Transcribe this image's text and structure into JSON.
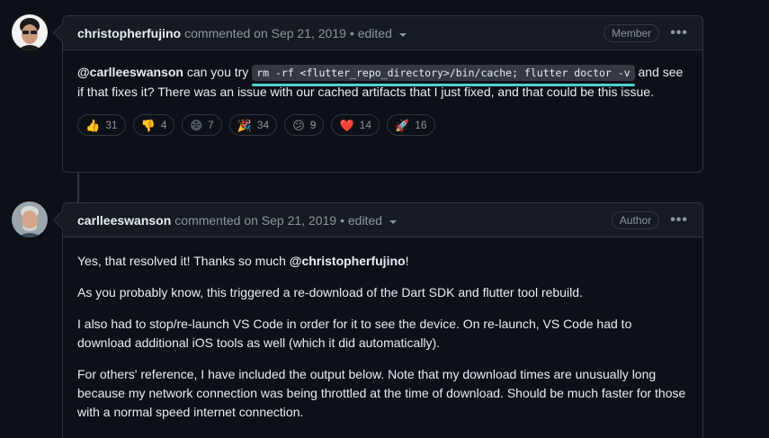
{
  "comments": [
    {
      "author": "christopherfujino",
      "meta": "commented on Sep 21, 2019",
      "edited": "• edited",
      "role": "Member",
      "more_label": "•••",
      "body": {
        "mention": "@carlleeswanson",
        "text_before_code": " can you try ",
        "code": "rm -rf <flutter_repo_directory>/bin/cache; flutter doctor -v",
        "text_after_code": " and see if that fixes it? There was an issue with our cached artifacts that I just fixed, and that could be this issue."
      },
      "reactions": [
        {
          "emoji": "👍",
          "icon": "thumbs-up-icon",
          "count": "31"
        },
        {
          "emoji": "👎",
          "icon": "thumbs-down-icon",
          "count": "4"
        },
        {
          "emoji": "😄",
          "icon": "laugh-icon",
          "count": "7"
        },
        {
          "emoji": "🎉",
          "icon": "hooray-icon",
          "count": "34"
        },
        {
          "emoji": "😕",
          "icon": "confused-icon",
          "count": "9"
        },
        {
          "emoji": "❤️",
          "icon": "heart-icon",
          "count": "14"
        },
        {
          "emoji": "🚀",
          "icon": "rocket-icon",
          "count": "16"
        }
      ]
    },
    {
      "author": "carlleeswanson",
      "meta": "commented on Sep 21, 2019",
      "edited": "• edited",
      "role": "Author",
      "more_label": "•••",
      "body": {
        "p1_before": "Yes, that resolved it! Thanks so much ",
        "p1_mention": "@christopherfujino",
        "p1_after": "!",
        "p2": "As you probably know, this triggered a re-download of the Dart SDK and flutter tool rebuild.",
        "p3": "I also had to stop/re-launch VS Code in order for it to see the device. On re-launch, VS Code had to download additional iOS tools as well (which it did automatically).",
        "p4": "For others' reference, I have included the output below. Note that my download times are unusually long because my network connection was being throttled at the time of download. Should be much faster for those with a normal speed internet connection."
      }
    }
  ],
  "colors": {
    "background": "#0d1117",
    "header_background": "#161b22",
    "border": "#30363d",
    "muted_text": "#8b949e",
    "highlight_underline": "#4fd1c5"
  }
}
